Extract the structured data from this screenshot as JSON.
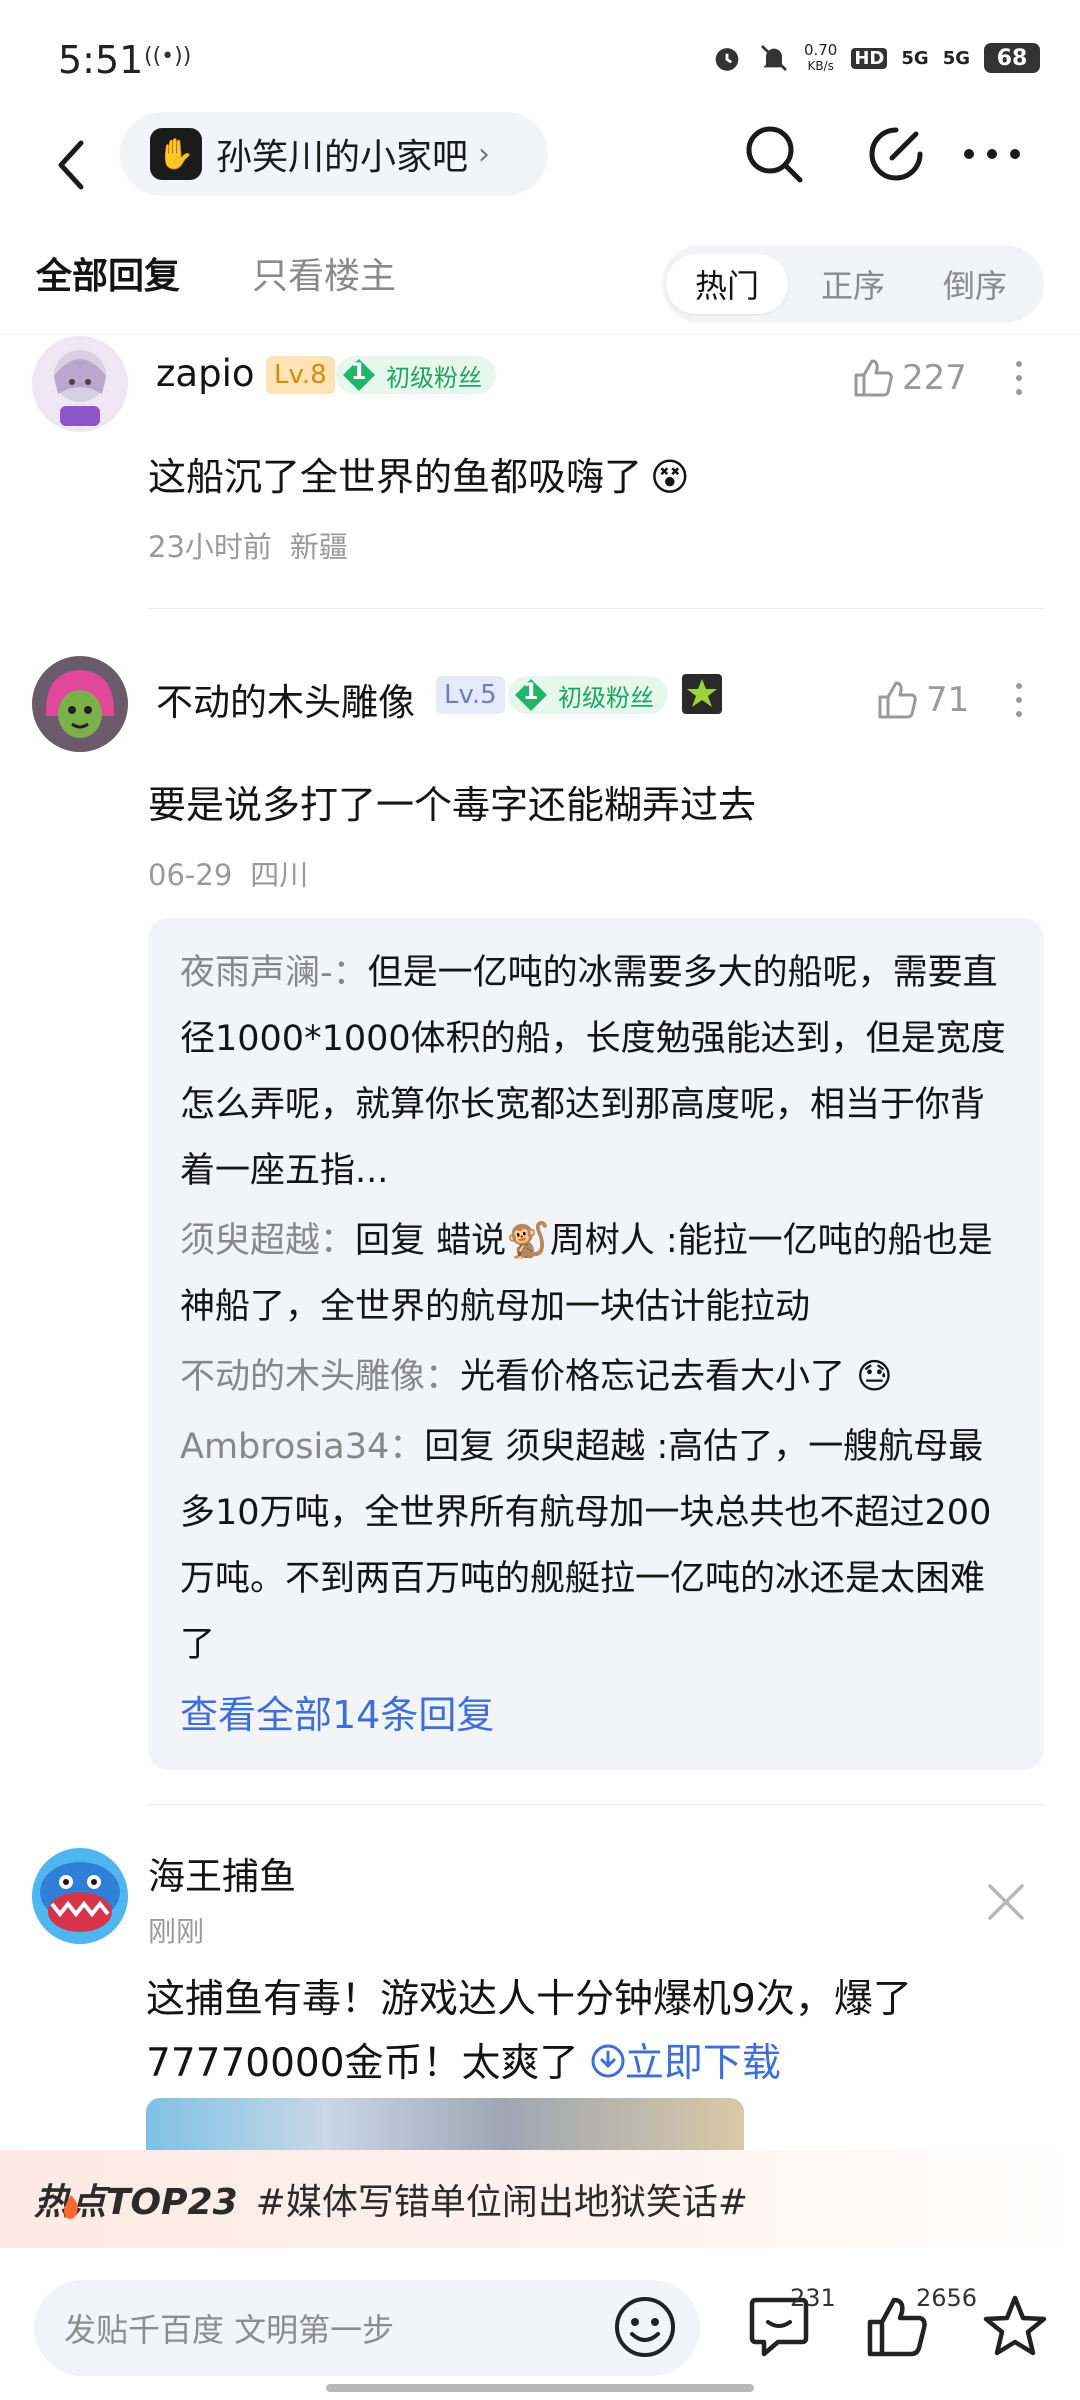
{
  "status_bar": {
    "time": "5:51",
    "net_speed_value": "0.70",
    "net_speed_unit": "KB/s",
    "hd_label": "HD",
    "signal_1": "5G",
    "signal_2": "5G",
    "battery": "68"
  },
  "nav": {
    "forum_name": "孙笑川的小家吧",
    "forum_avatar_glyph": "✋"
  },
  "filter": {
    "tab_all": "全部回复",
    "tab_op_only": "只看楼主",
    "sort_hot": "热门",
    "sort_asc": "正序",
    "sort_desc": "倒序"
  },
  "comments": [
    {
      "username": "zapio",
      "level": "Lv.8",
      "fan_num": "1",
      "fan_label": "初级粉丝",
      "likes": "227",
      "text": "这船沉了全世界的鱼都吸嗨了",
      "emoji": "😵",
      "time": "23小时前",
      "location": "新疆"
    },
    {
      "username": "不动的木头雕像",
      "level": "Lv.5",
      "fan_num": "1",
      "fan_label": "初级粉丝",
      "likes": "71",
      "text": "要是说多打了一个毒字还能糊弄过去",
      "time": "06-29",
      "location": "四川",
      "replies": [
        {
          "author": "夜雨声澜-：",
          "text": "但是一亿吨的冰需要多大的船呢，需要直径1000*1000体积的船，长度勉强能达到，但是宽度怎么弄呢，就算你长宽都达到那高度呢，相当于你背着一座五指..."
        },
        {
          "author": "须臾超越：",
          "text": "回复 蜡说🐒周树人 :能拉一亿吨的船也是神船了，全世界的航母加一块估计能拉动"
        },
        {
          "author": "不动的木头雕像：",
          "text": "光看价格忘记去看大小了 😓"
        },
        {
          "author": "Ambrosia34：",
          "text": "回复 须臾超越 :高估了，一艘航母最多10万吨，全世界所有航母加一块总共也不超过200万吨。不到两百万吨的舰艇拉一亿吨的冰还是太困难了"
        }
      ],
      "see_all": "查看全部14条回复"
    }
  ],
  "ad": {
    "name": "海王捕鱼",
    "time": "刚刚",
    "text": "这捕鱼有毒！游戏达人十分钟爆机9次，爆了77770000金币！太爽了",
    "download": "立即下载"
  },
  "hot": {
    "label": "热点TOP23",
    "topic": "#媒体写错单位闹出地狱笑话#"
  },
  "bottom": {
    "input_placeholder": "发贴千百度 文明第一步",
    "comment_count": "231",
    "like_count": "2656"
  },
  "colors": {
    "link": "#3c6fd8",
    "fan_green": "#1ea563",
    "level8": "#f3a52c",
    "level5": "#8a9bd4",
    "muted": "#9a9a9a"
  }
}
